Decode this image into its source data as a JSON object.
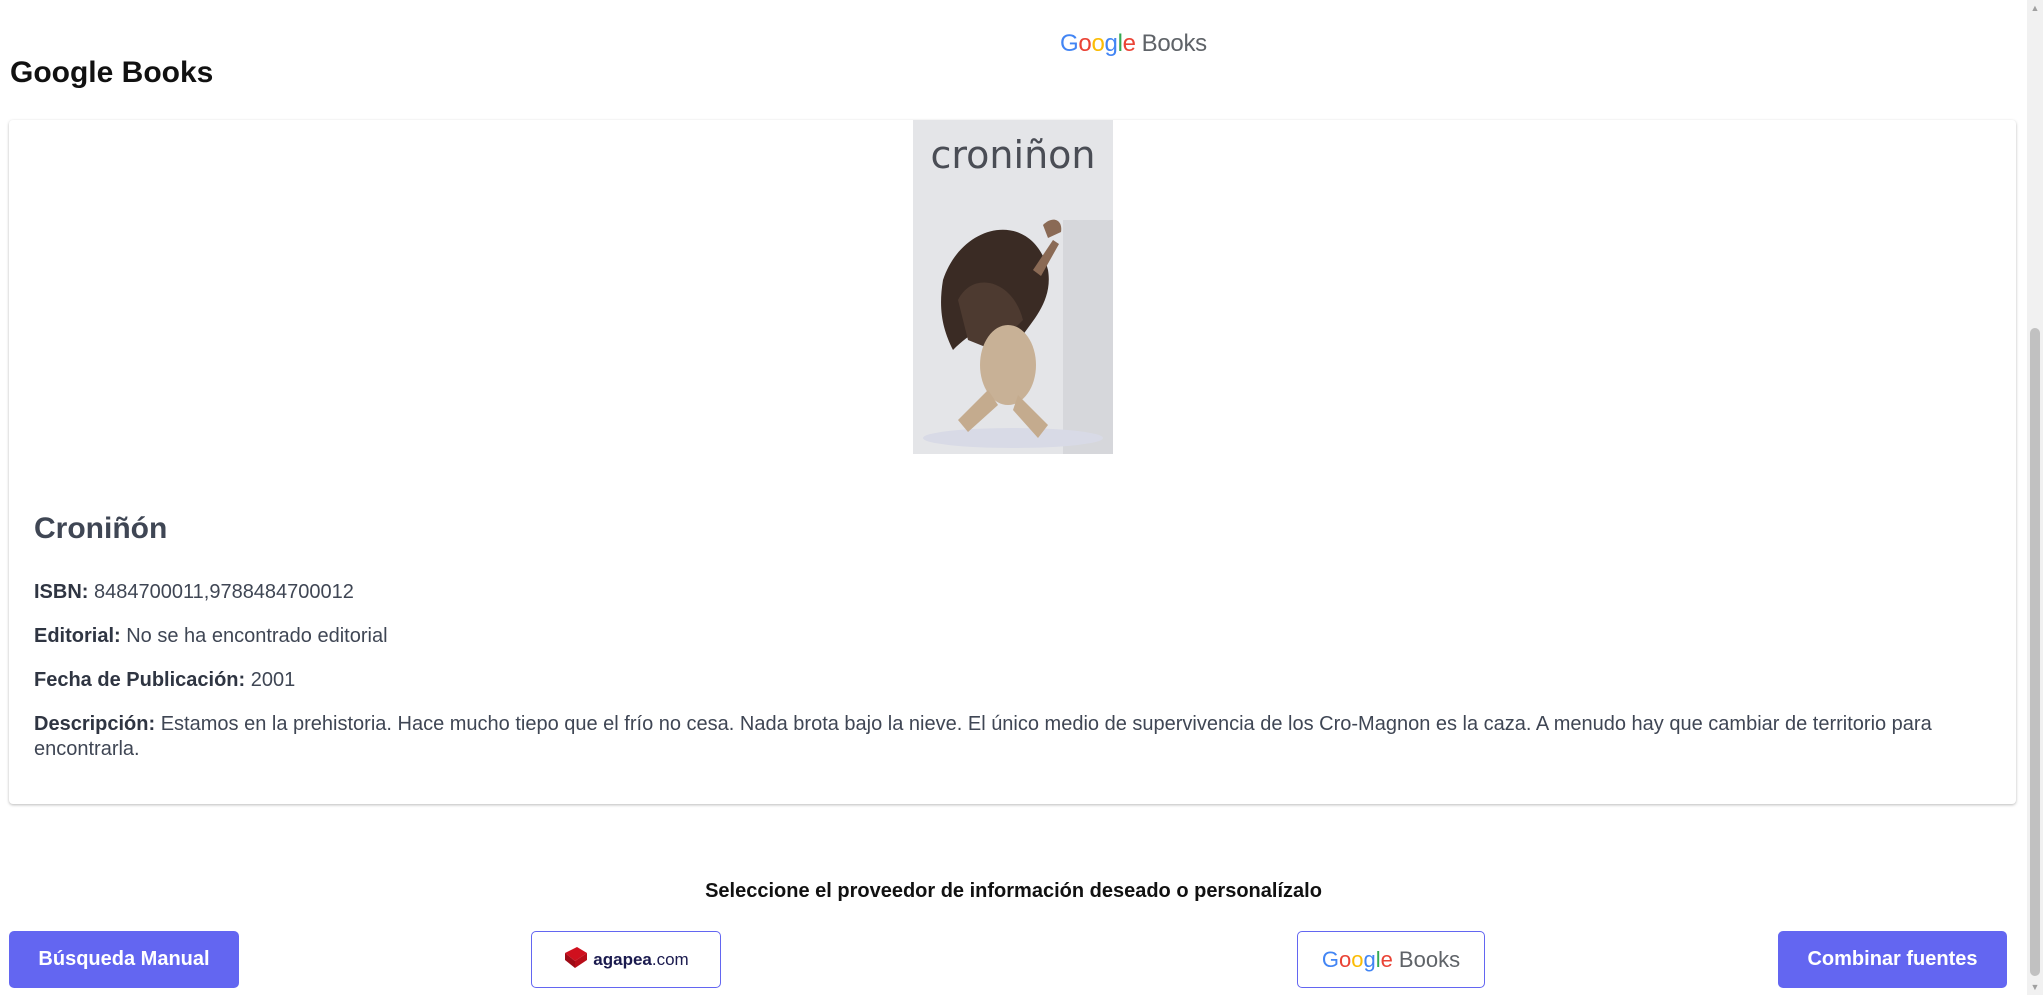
{
  "header": {
    "logo_google": "Google",
    "logo_books": "Books"
  },
  "section": {
    "title": "Google Books"
  },
  "book": {
    "cover_title": "croniñon",
    "title": "Croniñón",
    "isbn_label": "ISBN:",
    "isbn_value": "8484700011,9788484700012",
    "editorial_label": "Editorial:",
    "editorial_value": "No se ha encontrado editorial",
    "fecha_label": "Fecha de Publicación:",
    "fecha_value": "2001",
    "descripcion_label": "Descripción:",
    "descripcion_value": "Estamos en la prehistoria. Hace mucho tiepo que el frío no cesa. Nada brota bajo la nieve. El único medio de supervivencia de los Cro-Magnon es la caza. A menudo hay que cambiar de territorio para encontrarla."
  },
  "providers": {
    "prompt": "Seleccione el proveedor de información deseado o personalízalo",
    "manual_button": "Búsqueda Manual",
    "agapea_name": "agapea",
    "agapea_domain": ".com",
    "google_logo_google": "Google",
    "google_logo_books": "Books",
    "combine_button": "Combinar fuentes"
  },
  "colors": {
    "accent": "#6366f1",
    "text": "#3f4654",
    "google_blue": "#4285F4",
    "google_red": "#EA4335",
    "google_yellow": "#FBBC05",
    "google_green": "#34A853",
    "agapea_red": "#d0101e"
  },
  "icons": {
    "agapea": "agapea-book-icon",
    "google": "google-books-logo"
  }
}
